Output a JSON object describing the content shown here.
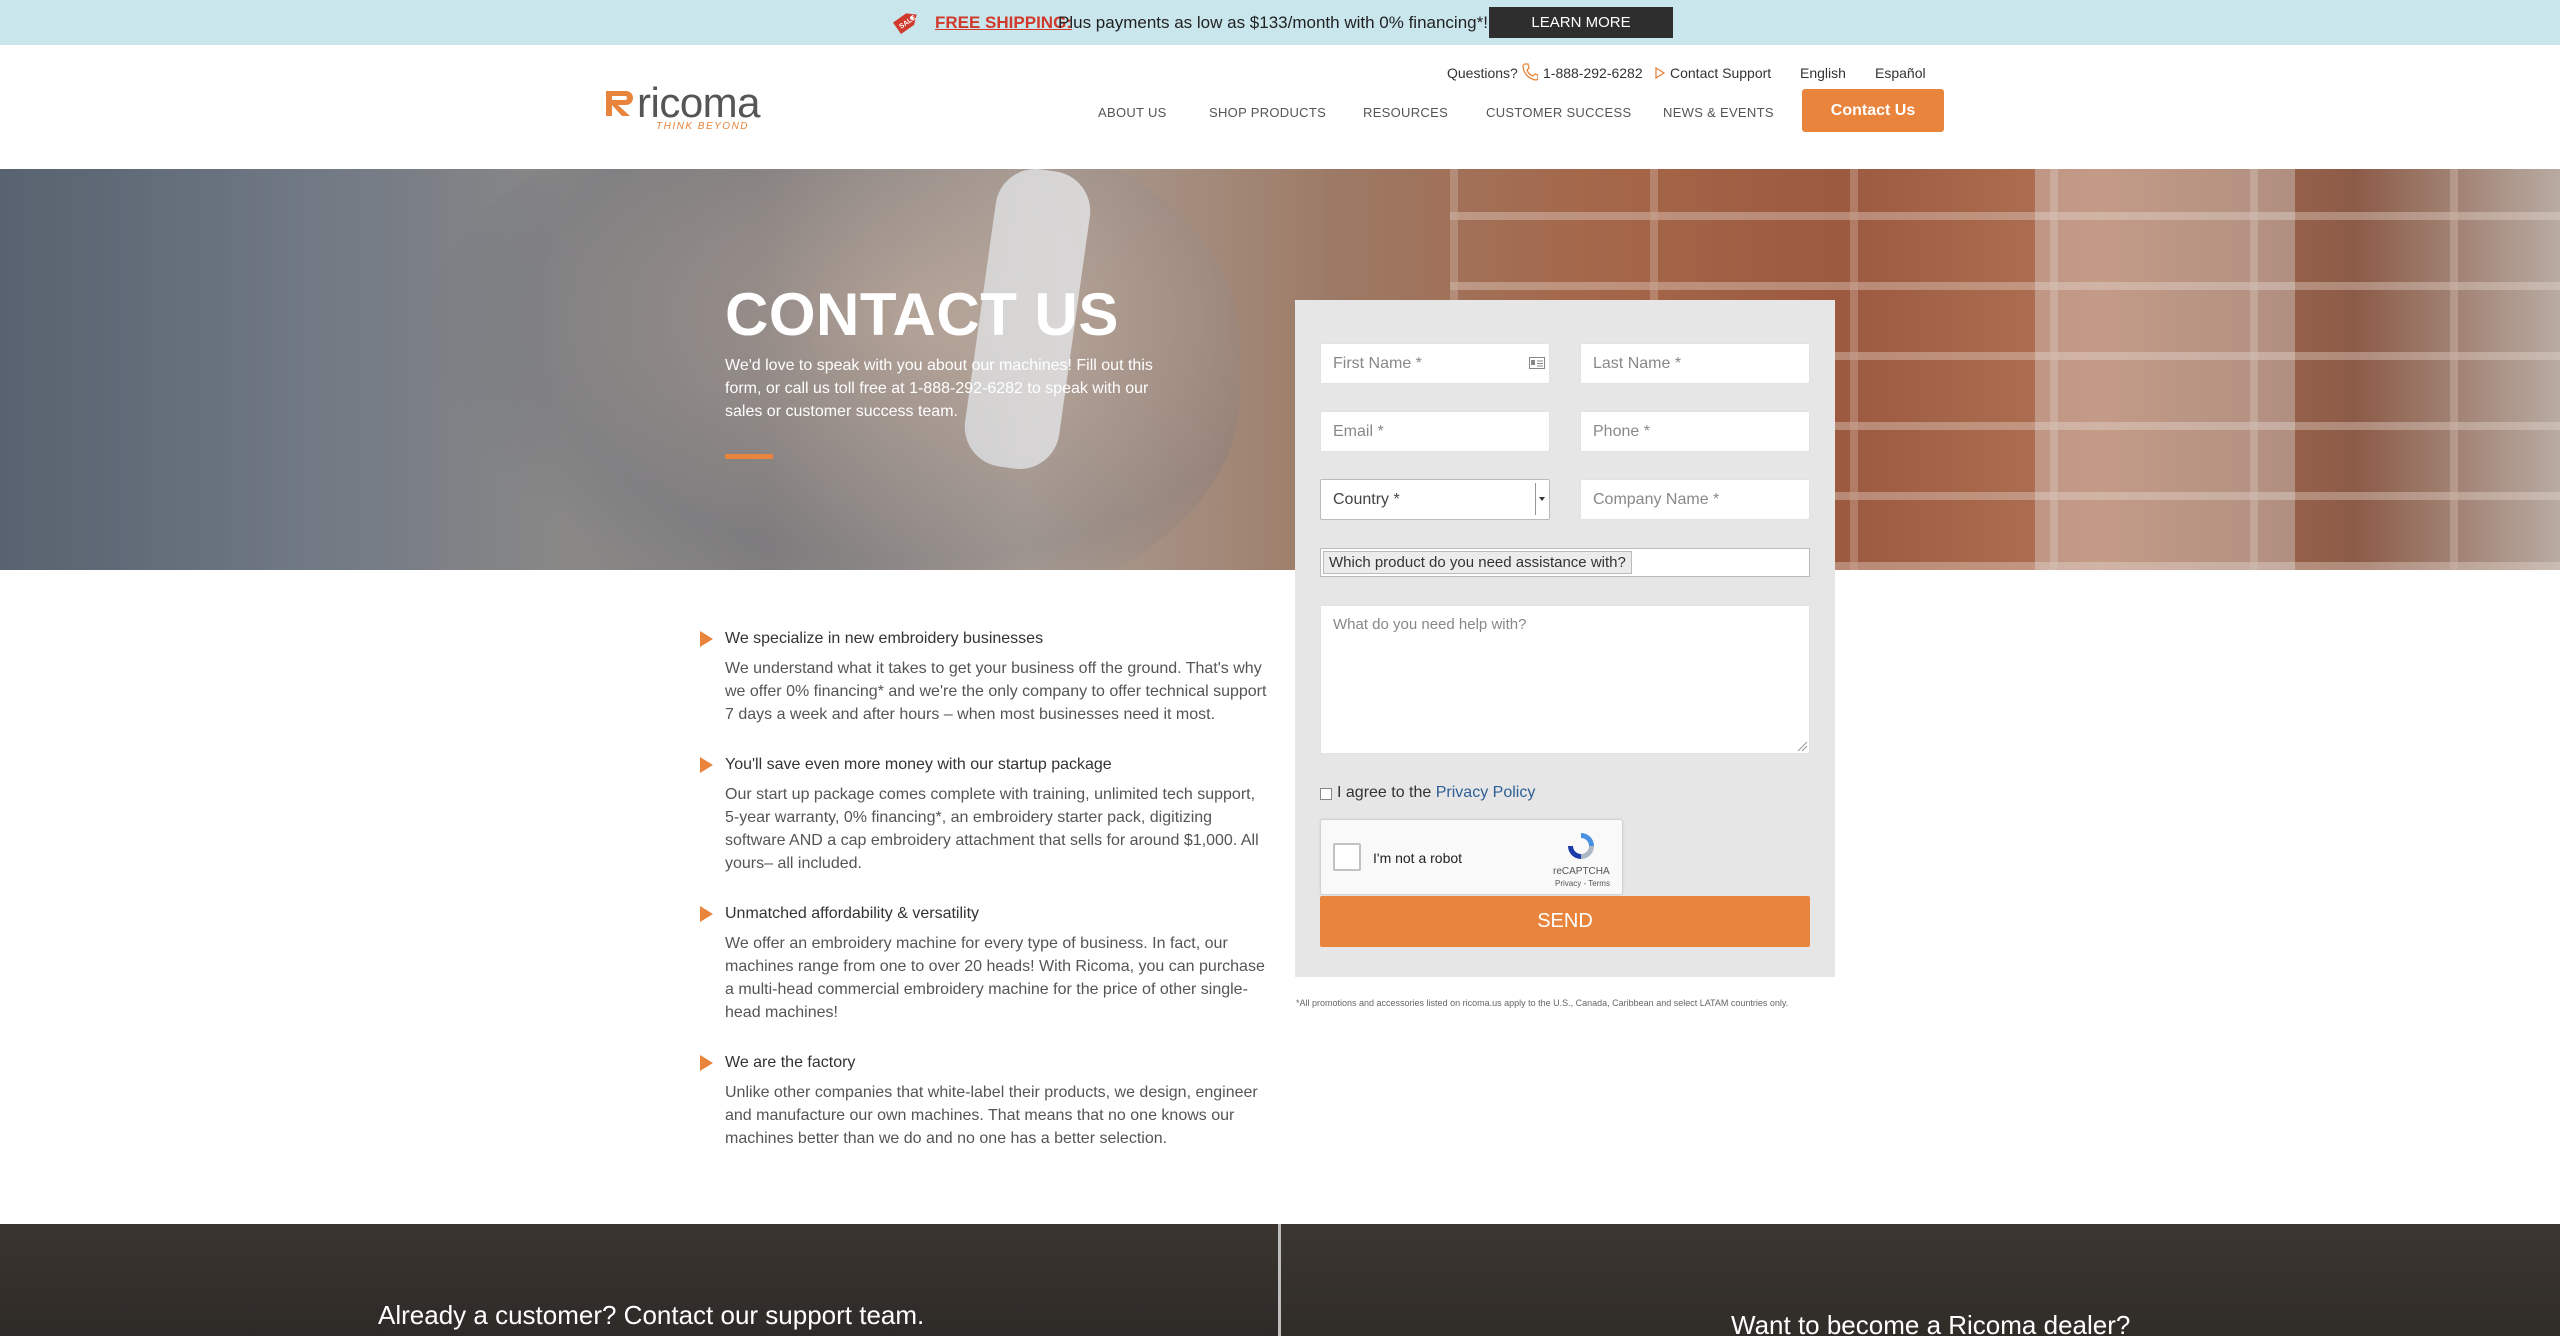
{
  "promo": {
    "tag_icon": "sale-tag-icon",
    "tag_text": "SALE",
    "free_shipping": "FREE SHIPPING:",
    "text": "Plus payments as low as $133/month with 0% financing*!",
    "button": "LEARN MORE"
  },
  "header": {
    "logo_word": "ricoma",
    "logo_tagline": "THINK BEYOND",
    "questions": "Questions?",
    "phone": "1-888-292-6282",
    "support": "Contact Support",
    "lang_en": "English",
    "lang_es": "Español",
    "nav": [
      "ABOUT US",
      "SHOP PRODUCTS",
      "RESOURCES",
      "CUSTOMER SUCCESS",
      "NEWS & EVENTS"
    ],
    "contact_button": "Contact Us"
  },
  "hero": {
    "title": "CONTACT US",
    "subtitle": "We'd love to speak with you about our machines! Fill out this form, or call us toll free at 1-888-292-6282 to speak with our sales or customer success team."
  },
  "form": {
    "first_name": "First Name *",
    "last_name": "Last Name *",
    "email": "Email *",
    "phone": "Phone *",
    "country": "Country *",
    "company": "Company Name *",
    "product": "Which product do you need assistance with?",
    "message": "What do you need help with?",
    "agree": "I agree to the",
    "privacy": "Privacy Policy",
    "captcha_label": "I'm not a robot",
    "captcha_brand": "reCAPTCHA",
    "captcha_terms": "Privacy - Terms",
    "send": "SEND",
    "disclaimer": "*All promotions and accessories listed on ricoma.us apply to the U.S., Canada, Caribbean and select LATAM countries only."
  },
  "features": [
    {
      "title": "We specialize in new embroidery businesses",
      "body": "We understand what it takes to get your business off the ground. That's why we offer 0% financing* and we're the only company to offer technical support 7 days a week and after hours – when most businesses need it most."
    },
    {
      "title": "You'll save even more money with our startup package",
      "body": "Our start up package comes complete with training, unlimited tech support, 5-year warranty, 0% financing*, an embroidery starter pack, digitizing software AND a cap embroidery attachment that sells for around $1,000. All yours– all included."
    },
    {
      "title": "Unmatched affordability & versatility",
      "body": "We offer an embroidery machine for every type of business. In fact, our machines range from one to over 20 heads! With Ricoma, you can purchase a multi-head commercial embroidery machine for the price of other single-head machines!"
    },
    {
      "title": "We are the factory",
      "body": "Unlike other companies that white-label their products, we design, engineer and manufacture our own machines. That means that no one knows our machines better than we do and no one has a better selection."
    }
  ],
  "footer": {
    "left": "Already a customer? Contact our support team.",
    "right": "Want to become a Ricoma dealer?"
  },
  "colors": {
    "accent": "#e8843c",
    "promo_bg": "#c9e6ed",
    "sale_red": "#d0392b",
    "link_blue": "#2f5f95"
  }
}
